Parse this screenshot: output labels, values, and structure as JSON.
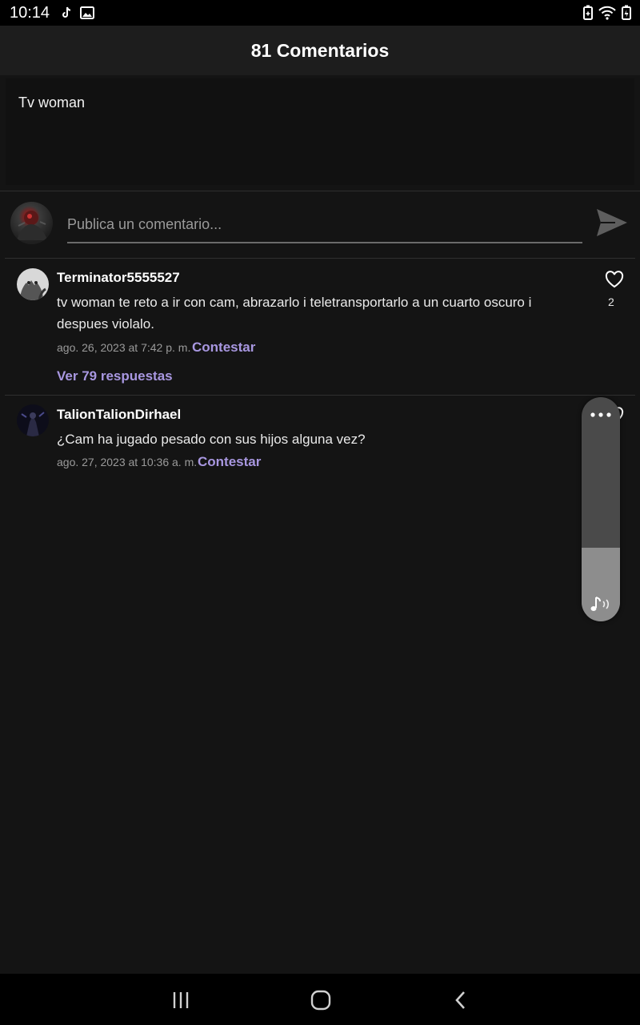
{
  "status_bar": {
    "time": "10:14",
    "left_icons": [
      "tiktok-icon",
      "image-icon"
    ],
    "right_icons": [
      "battery-saver-icon",
      "wifi-icon",
      "battery-icon"
    ]
  },
  "header": {
    "title": "81 Comentarios"
  },
  "post": {
    "text": "Tv woman"
  },
  "compose": {
    "placeholder": "Publica un comentario...",
    "send_icon": "send-icon"
  },
  "comments": [
    {
      "username": "Terminator5555527",
      "text": "tv woman te reto a ir con cam, abrazarlo i teletransportarlo a un cuarto oscuro i despues violalo.",
      "date": "ago. 26, 2023 at 7:42 p. m.",
      "reply_label": "Contestar",
      "likes": "2",
      "replies_label": "Ver 79 respuestas"
    },
    {
      "username": "TalionTalionDirhael",
      "text": "¿Cam ha jugado pesado con sus hijos alguna vez?",
      "date": "ago. 27, 2023 at 10:36 a. m.",
      "reply_label": "Contestar"
    }
  ],
  "floating_panel": {
    "level": 0.33,
    "icons": [
      "more-dots-icon",
      "music-note-icon"
    ]
  },
  "nav_bar": {
    "buttons": [
      "recent-apps-icon",
      "home-icon",
      "back-icon"
    ]
  },
  "colors": {
    "background": "#141414",
    "accent": "#a897e0",
    "header": "#1d1d1d"
  }
}
